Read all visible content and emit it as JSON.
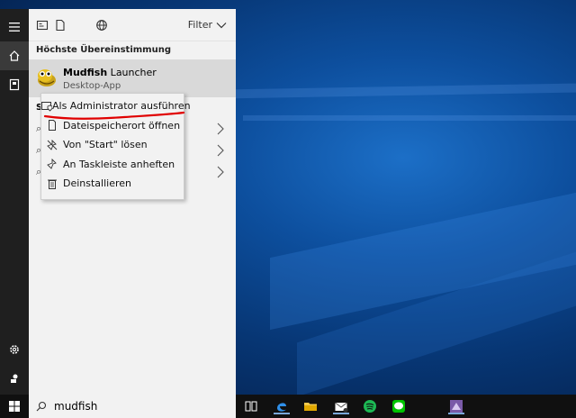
{
  "panel": {
    "filter_label": "Filter",
    "best_match_heading": "Höchste Übereinstimmung",
    "best_match": {
      "name_bold": "Mudfish",
      "name_rest": " Launcher",
      "type": "Desktop-App"
    },
    "covered_section_letter": "S"
  },
  "context_menu": {
    "items": [
      {
        "label": "Als Administrator ausführen",
        "icon": "shield-window-icon"
      },
      {
        "label": "Dateispeicherort öffnen",
        "icon": "file-icon"
      },
      {
        "label": "Von \"Start\" lösen",
        "icon": "unpin-icon"
      },
      {
        "label": "An Taskleiste anheften",
        "icon": "pin-icon"
      },
      {
        "label": "Deinstallieren",
        "icon": "trash-icon"
      }
    ]
  },
  "taskbar": {
    "search_value": "mudfish",
    "apps": [
      "task-view-icon",
      "edge-icon",
      "file-explorer-icon",
      "mail-icon",
      "spotify-icon",
      "line-icon",
      "mudfish-icon"
    ]
  },
  "colors": {
    "panel_bg": "#f2f2f2",
    "highlight": "#d9d9d9",
    "rail_bg": "#1f1f1f",
    "annotation_red": "#e00000"
  }
}
